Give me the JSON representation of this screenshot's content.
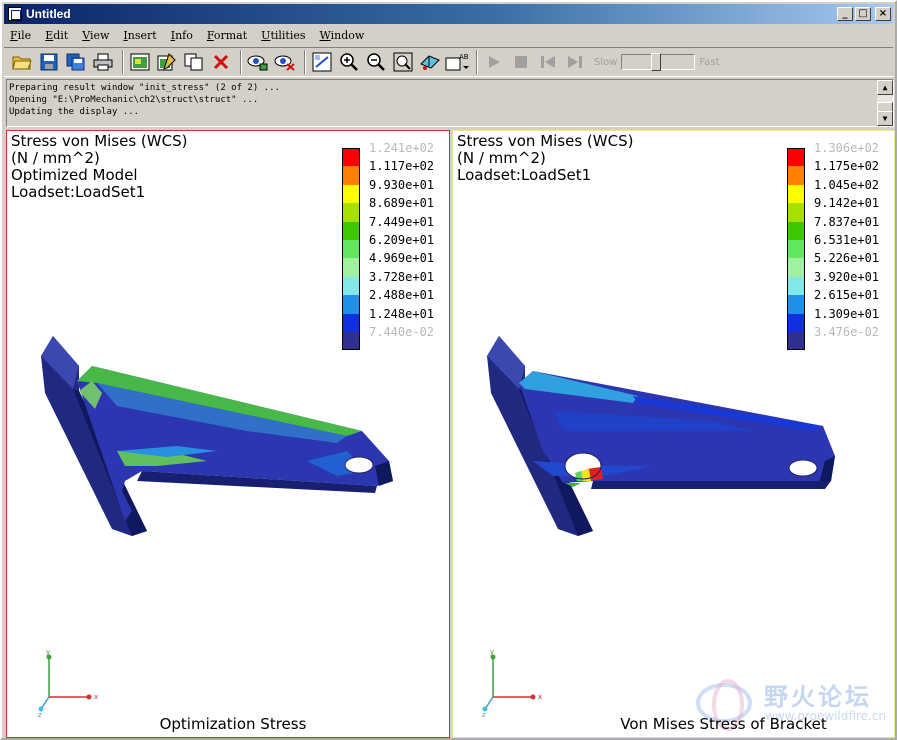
{
  "window": {
    "title": "Untitled",
    "minimize": "_",
    "restore": "□",
    "close": "×"
  },
  "menu": [
    {
      "label": "File",
      "key": "F",
      "rest": "ile"
    },
    {
      "label": "Edit",
      "key": "E",
      "rest": "dit"
    },
    {
      "label": "View",
      "key": "V",
      "rest": "iew"
    },
    {
      "label": "Insert",
      "key": "I",
      "rest": "nsert"
    },
    {
      "label": "Info",
      "key": "I",
      "rest": "nfo"
    },
    {
      "label": "Format",
      "key": "F",
      "rest": "ormat"
    },
    {
      "label": "Utilities",
      "key": "U",
      "rest": "tilities"
    },
    {
      "label": "Window",
      "key": "W",
      "rest": "indow"
    }
  ],
  "toolbar": {
    "open_icon": "folder-open-icon",
    "save_icon": "save-icon",
    "slow_label": "Slow",
    "fast_label": "Fast",
    "speed_level": 0.45
  },
  "messages": [
    "Preparing result window \"init_stress\" (2 of 2) ...",
    "Opening \"E:\\ProMechanic\\ch2\\struct\\struct\" ...",
    "Updating the display ..."
  ],
  "left_view": {
    "title_lines": [
      "Stress von Mises (WCS)",
      "(N / mm^2)",
      "Optimized Model",
      "Loadset:LoadSet1"
    ],
    "legend_values": [
      "1.241e+02",
      "1.117e+02",
      "9.930e+01",
      "8.689e+01",
      "7.449e+01",
      "6.209e+01",
      "4.969e+01",
      "3.728e+01",
      "2.488e+01",
      "1.248e+01",
      "7.440e-02"
    ],
    "caption": "Optimization Stress"
  },
  "right_view": {
    "title_lines": [
      "Stress von Mises (WCS)",
      "(N / mm^2)",
      "Loadset:LoadSet1"
    ],
    "legend_values": [
      "1.306e+02",
      "1.175e+02",
      "1.045e+02",
      "9.142e+01",
      "7.837e+01",
      "6.531e+01",
      "5.226e+01",
      "3.920e+01",
      "2.615e+01",
      "1.309e+01",
      "3.476e-02"
    ],
    "caption": "Von Mises Stress of Bracket"
  },
  "legend_colors": [
    "#ff0000",
    "#ff7f00",
    "#ffff00",
    "#a8e000",
    "#3cc800",
    "#60e860",
    "#a0f0a0",
    "#80e8e8",
    "#2090e8",
    "#1030e0",
    "#303090"
  ],
  "triad": {
    "x": "x",
    "y": "y",
    "z": "z"
  },
  "watermark": {
    "cn": "野火论坛",
    "url": "www.proewildfire.cn"
  }
}
